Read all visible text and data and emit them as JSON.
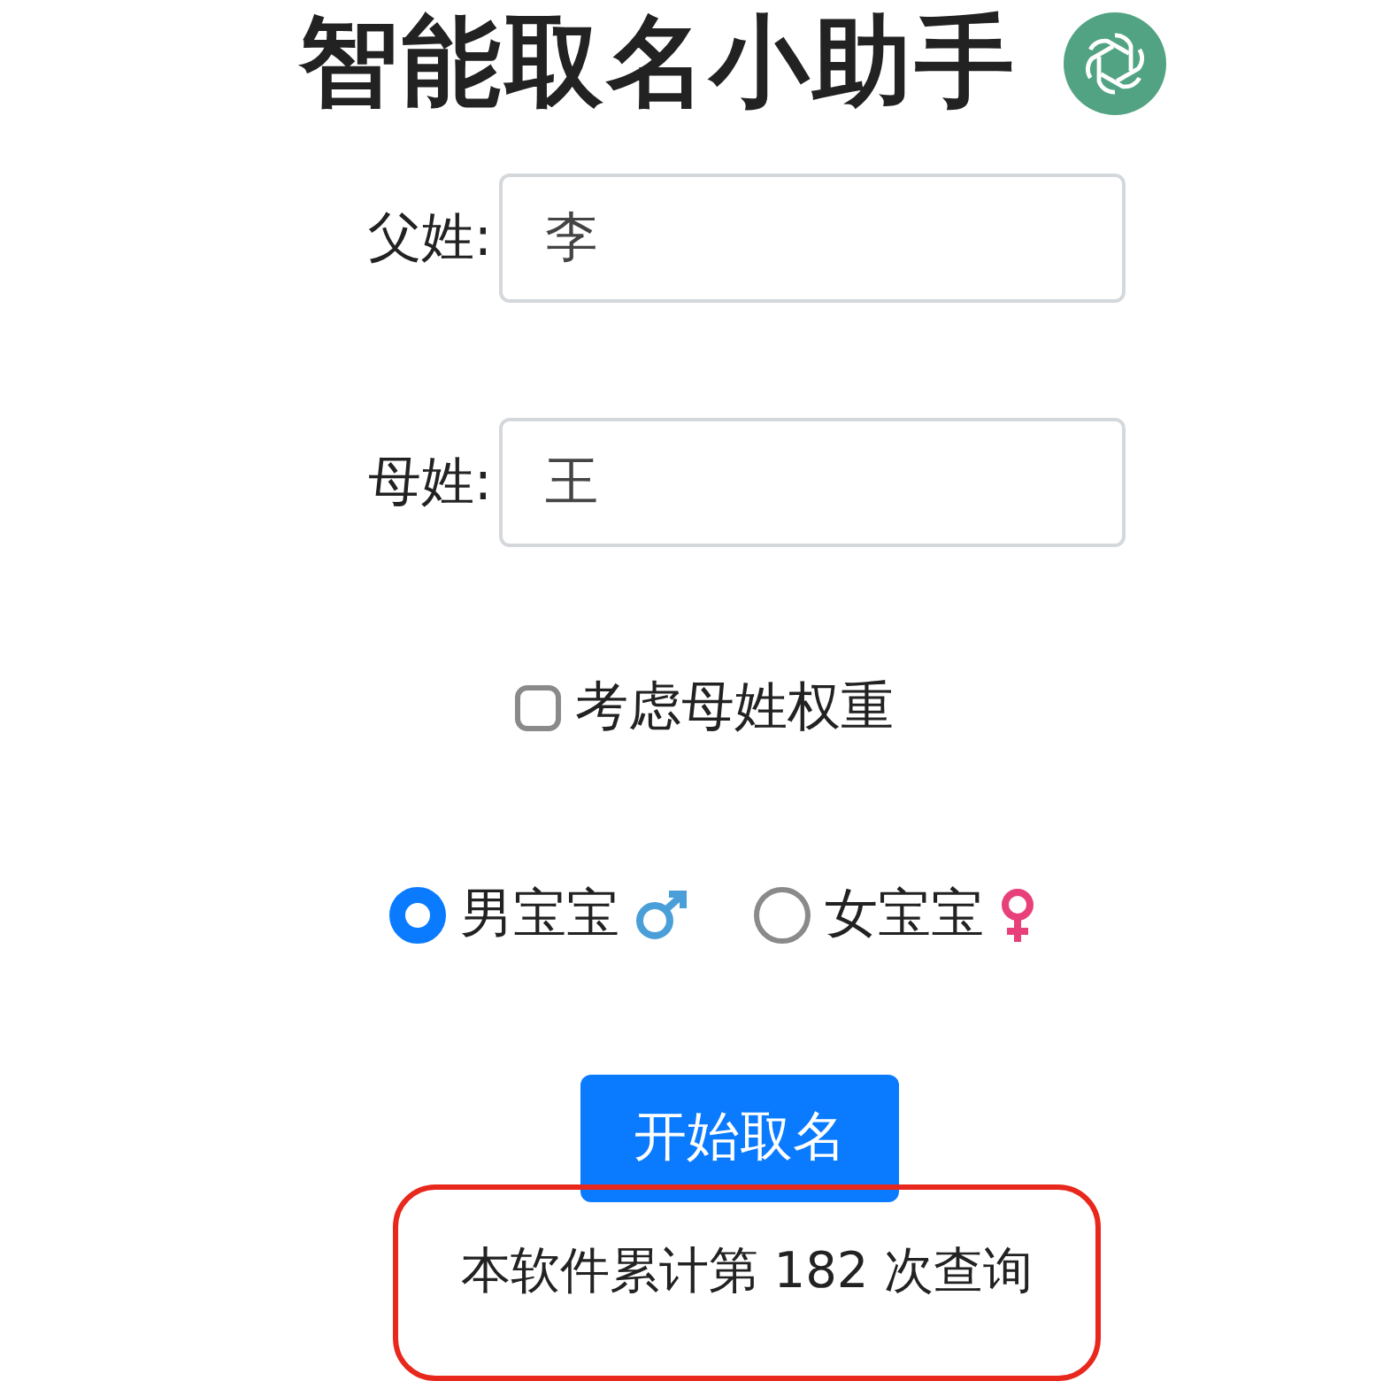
{
  "title": "智能取名小助手",
  "fields": [
    {
      "label": "父姓:",
      "value": "李"
    },
    {
      "label": "母姓:",
      "value": "王"
    }
  ],
  "option": {
    "label": "考虑母姓权重",
    "checked": false
  },
  "genders": [
    {
      "label": "男宝宝",
      "kind": "male",
      "selected": true
    },
    {
      "label": "女宝宝",
      "kind": "female",
      "selected": false
    }
  ],
  "button": "开始取名",
  "footer": {
    "text": "本软件累计第 182 次查询",
    "highlighted": true
  }
}
